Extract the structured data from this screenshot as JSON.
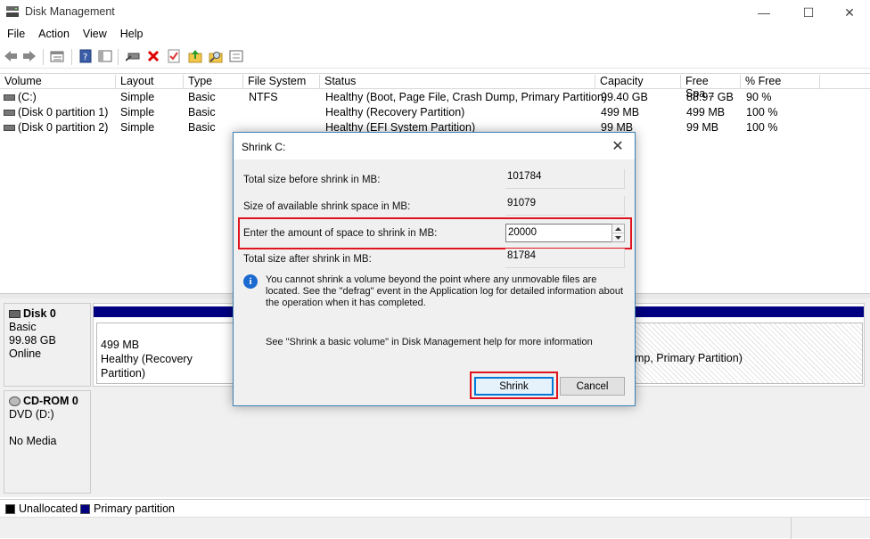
{
  "window": {
    "title": "Disk Management",
    "icon": "disk-management-icon",
    "controls": {
      "minimize": "—",
      "maximize": "☐",
      "close": "✕"
    }
  },
  "menu": [
    "File",
    "Action",
    "View",
    "Help"
  ],
  "toolbar": {
    "icons": [
      "back-arrow-icon",
      "forward-arrow-icon",
      "properties-list-icon",
      "help-icon",
      "console-pane-icon",
      "connect-drive-icon",
      "delete-icon",
      "checklist-icon",
      "up-folder-icon",
      "search-folder-icon",
      "panel-icon"
    ]
  },
  "volume_table": {
    "columns": [
      "Volume",
      "Layout",
      "Type",
      "File System",
      "Status",
      "Capacity",
      "Free Spa...",
      "% Free"
    ],
    "rows": [
      {
        "volume": "(C:)",
        "layout": "Simple",
        "type": "Basic",
        "fs": "NTFS",
        "status": "Healthy (Boot, Page File, Crash Dump, Primary Partition)",
        "capacity": "99.40 GB",
        "free": "88.97 GB",
        "pct": "90 %"
      },
      {
        "volume": "(Disk 0 partition 1)",
        "layout": "Simple",
        "type": "Basic",
        "fs": "",
        "status": "Healthy (Recovery Partition)",
        "capacity": "499 MB",
        "free": "499 MB",
        "pct": "100 %"
      },
      {
        "volume": "(Disk 0 partition 2)",
        "layout": "Simple",
        "type": "Basic",
        "fs": "",
        "status": "Healthy (EFI System Partition)",
        "capacity": "99 MB",
        "free": "99 MB",
        "pct": "100 %"
      }
    ]
  },
  "disks": [
    {
      "name": "Disk 0",
      "type": "Basic",
      "size": "99.98 GB",
      "state": "Online",
      "partitions": [
        {
          "size": "499 MB",
          "status": "Healthy (Recovery Partition)"
        },
        {
          "size": "",
          "status": "mp, Primary Partition)"
        }
      ]
    },
    {
      "name": "CD-ROM 0",
      "type": "DVD (D:)",
      "size": "",
      "state": "No Media"
    }
  ],
  "legend": [
    {
      "label": "Unallocated",
      "color": "#000000"
    },
    {
      "label": "Primary partition",
      "color": "#000080"
    }
  ],
  "dialog": {
    "title": "Shrink C:",
    "fields": [
      {
        "label": "Total size before shrink in MB:",
        "value": "101784"
      },
      {
        "label": "Size of available shrink space in MB:",
        "value": "91079"
      },
      {
        "label": "Enter the amount of space to shrink in MB:",
        "value": "20000"
      },
      {
        "label": "Total size after shrink in MB:",
        "value": "81784"
      }
    ],
    "info": "You cannot shrink a volume beyond the point where any unmovable files are located. See the \"defrag\" event in the Application log for detailed information about the operation when it has completed.",
    "help": "See \"Shrink a basic volume\" in Disk Management help for more information",
    "buttons": {
      "shrink": "Shrink",
      "cancel": "Cancel"
    },
    "highlight_color": "#e0141e"
  }
}
